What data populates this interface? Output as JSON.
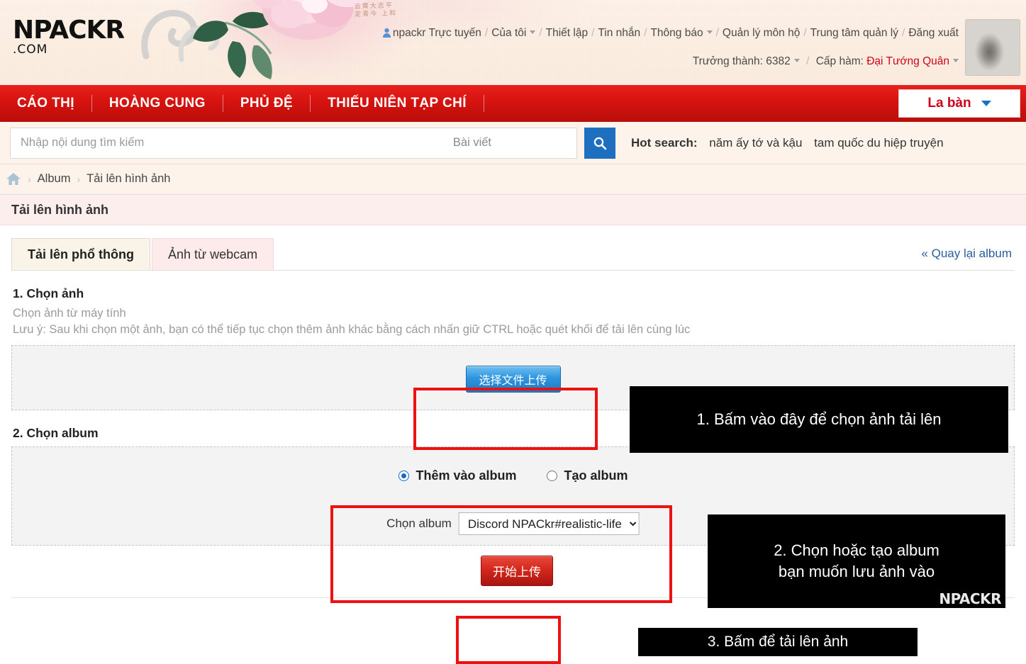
{
  "site": {
    "logo_main": "NPACKR",
    "logo_sub": ".COM",
    "calligraphy": "云 霄 大 志 平\n定 青 今   上 和"
  },
  "header": {
    "user_icon": "user-icon",
    "links": [
      {
        "label": "npackr Trực tuyến",
        "caret": false
      },
      {
        "label": "Của tôi",
        "caret": true
      },
      {
        "label": "Thiết lập",
        "caret": false
      },
      {
        "label": "Tin nhắn",
        "caret": false
      },
      {
        "label": "Thông báo",
        "caret": true
      },
      {
        "label": "Quản lý môn hộ",
        "caret": false
      },
      {
        "label": "Trung tâm quản lý",
        "caret": false
      },
      {
        "label": "Đăng xuất",
        "caret": false
      }
    ],
    "stats": {
      "growth_label": "Trưởng thành:",
      "growth_value": "6382",
      "rank_label": "Cấp hàm:",
      "rank_value": "Đại Tướng Quân"
    },
    "avatar_alt": "avatar"
  },
  "nav": {
    "items": [
      "CÁO THỊ",
      "HOÀNG CUNG",
      "PHỦ ĐỆ",
      "THIẾU NIÊN TẠP CHÍ"
    ],
    "compass_label": "La bàn"
  },
  "search": {
    "placeholder": "Nhập nội dung tìm kiếm",
    "value": "",
    "scope": "Bài viết",
    "button_icon": "search-icon",
    "hot_label": "Hot search:",
    "hot_items": [
      "năm ấy tớ và kậu",
      "tam quốc du hiệp truyện"
    ]
  },
  "breadcrumb": {
    "home_icon": "home-icon",
    "items": [
      "Album",
      "Tải lên hình ảnh"
    ],
    "separator": "›"
  },
  "panel": {
    "title": "Tải lên hình ảnh",
    "tabs": [
      {
        "label": "Tải lên phổ thông",
        "active": true
      },
      {
        "label": "Ảnh từ webcam",
        "active": false
      }
    ],
    "back_link": "« Quay lại album"
  },
  "step1": {
    "heading": "1. Chọn ảnh",
    "note1": "Chọn ảnh từ máy tính",
    "note2": "Lưu ý: Sau khi chọn một ảnh, bạn có thể tiếp tục chọn thêm ảnh khác bằng cách nhấn giữ CTRL hoặc quét khối để tải lên cùng lúc",
    "choose_button": "选择文件上传",
    "annotation": "1. Bấm vào đây để chọn ảnh tải lên"
  },
  "step2": {
    "heading": "2. Chọn album",
    "radio_add": "Thêm vào album",
    "radio_create": "Tạo album",
    "selected_radio": "add",
    "select_label": "Chọn album",
    "select_value": "Discord NPACkr#realistic-life",
    "select_options": [
      "Discord NPACkr#realistic-life"
    ],
    "annotation_line1": "2. Chọn hoặc tạo album",
    "annotation_line2": "bạn muốn lưu ảnh vào",
    "watermark": "NPACKR"
  },
  "step3": {
    "upload_button": "开始上传",
    "annotation": "3. Bấm để tải lên ảnh"
  },
  "colors": {
    "brand_red": "#d6130f",
    "accent_blue": "#1f6fc0",
    "highlight_red": "#ee1111",
    "panel_pink": "#fdeeee",
    "header_cream": "#fdf3ea"
  }
}
